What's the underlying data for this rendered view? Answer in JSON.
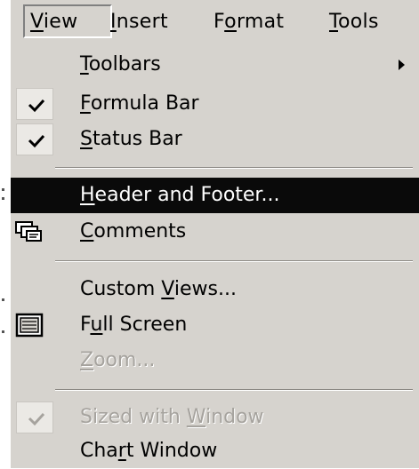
{
  "menubar": {
    "items": [
      {
        "label": "View"
      },
      {
        "label": "Insert"
      },
      {
        "label": "Format"
      },
      {
        "label": "Tools"
      }
    ]
  },
  "menu": {
    "toolbars": "Toolbars",
    "formula_bar": "Formula Bar",
    "status_bar": "Status Bar",
    "header_footer": "Header and Footer...",
    "comments": "Comments",
    "custom_views": "Custom Views...",
    "full_screen": "Full Screen",
    "zoom": "Zoom...",
    "sized_with_window": "Sized with Window",
    "chart_window": "Chart Window"
  },
  "state": {
    "formula_bar_checked": true,
    "status_bar_checked": true,
    "sized_with_window_checked": true,
    "highlighted_item": "Header and Footer..."
  },
  "colors": {
    "menu_bg": "#d6d3ce",
    "highlight": "#0a0a0a",
    "disabled_text": "#a6a39e"
  }
}
